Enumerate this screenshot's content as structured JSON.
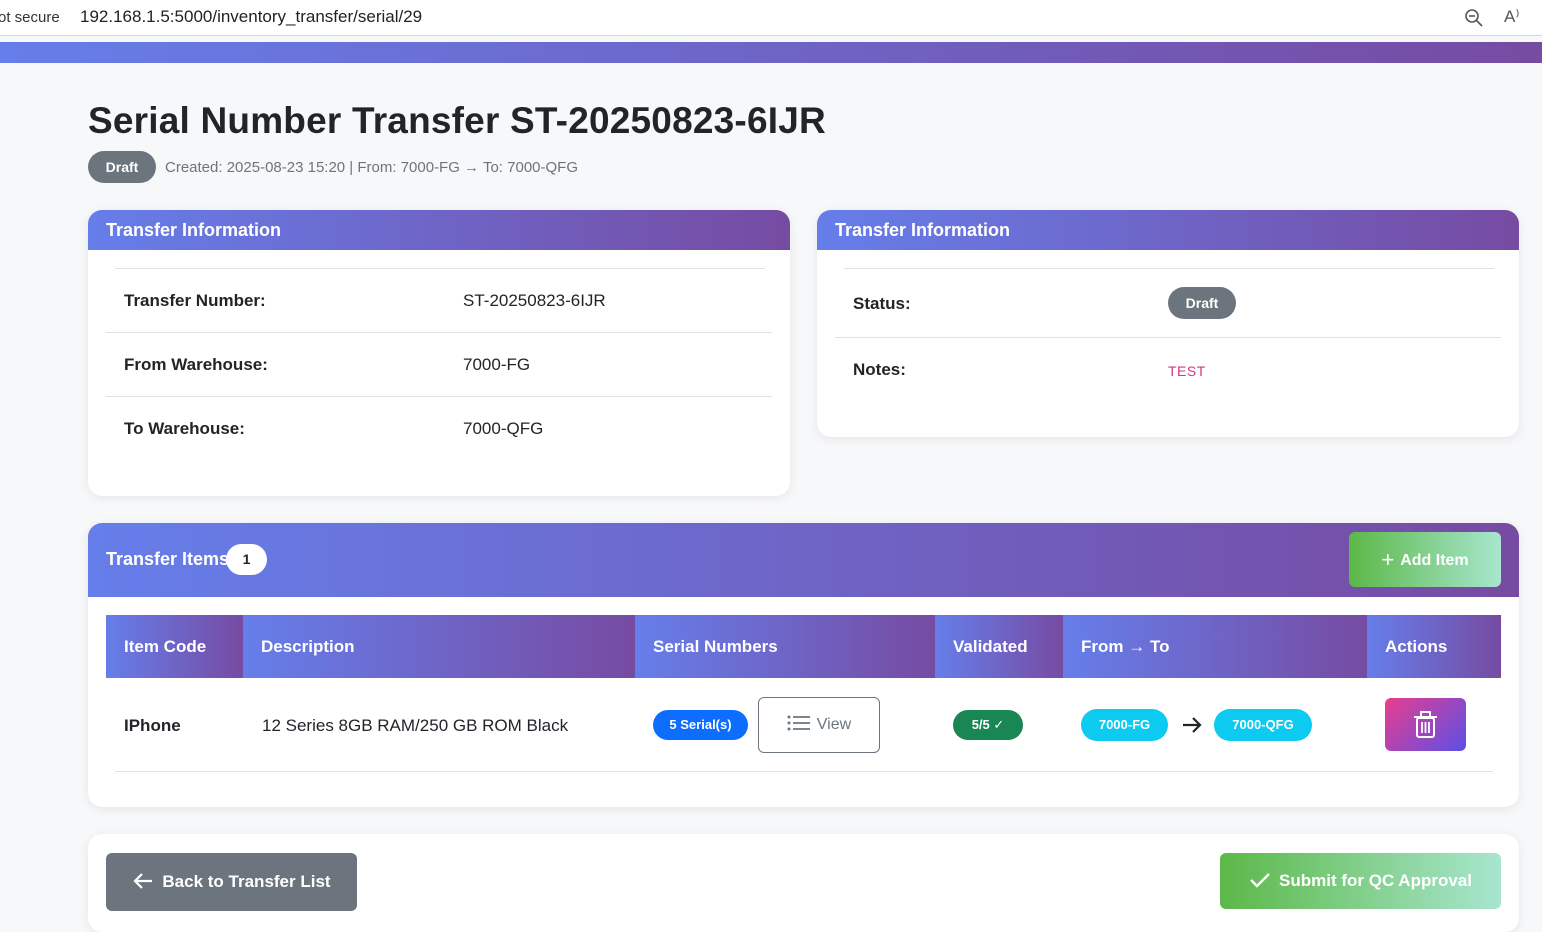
{
  "browser": {
    "secure_label": "ot secure",
    "url": "192.168.1.5:5000/inventory_transfer/serial/29",
    "read_aloud": "A⁾"
  },
  "page": {
    "title": "Serial Number Transfer ST-20250823-6IJR",
    "status_badge": "Draft",
    "meta": "Created: 2025-08-23 15:20 | From: 7000-FG → To: 7000-QFG"
  },
  "info_left": {
    "header": "Transfer Information",
    "rows": [
      {
        "label": "Transfer Number:",
        "value": "ST-20250823-6IJR"
      },
      {
        "label": "From Warehouse:",
        "value": "7000-FG"
      },
      {
        "label": "To Warehouse:",
        "value": "7000-QFG"
      }
    ]
  },
  "info_right": {
    "header": "Transfer Information",
    "status_label": "Status:",
    "status_value": "Draft",
    "notes_label": "Notes:",
    "notes_value": "TEST"
  },
  "items": {
    "title": "Transfer Items",
    "count": "1",
    "add_label": "Add Item",
    "columns": [
      "Item Code",
      "Description",
      "Serial Numbers",
      "Validated",
      "From → To",
      "Actions"
    ],
    "rows": [
      {
        "item_code": "IPhone",
        "description": "12 Series 8GB RAM/250 GB ROM Black",
        "serials": "5 Serial(s)",
        "view_label": "View",
        "validated": "5/5 ✓",
        "from": "7000-FG",
        "to": "7000-QFG"
      }
    ]
  },
  "footer": {
    "back_label": "Back to Transfer List",
    "submit_label": "Submit for QC Approval"
  },
  "colors": {
    "header_gradient_start": "#667eea",
    "header_gradient_end": "#764ba2",
    "draft": "#6c757d",
    "serial_badge": "#0d6efd",
    "validated_badge": "#198754",
    "warehouse_badge": "#0dcaf0",
    "notes": "#d63384"
  }
}
